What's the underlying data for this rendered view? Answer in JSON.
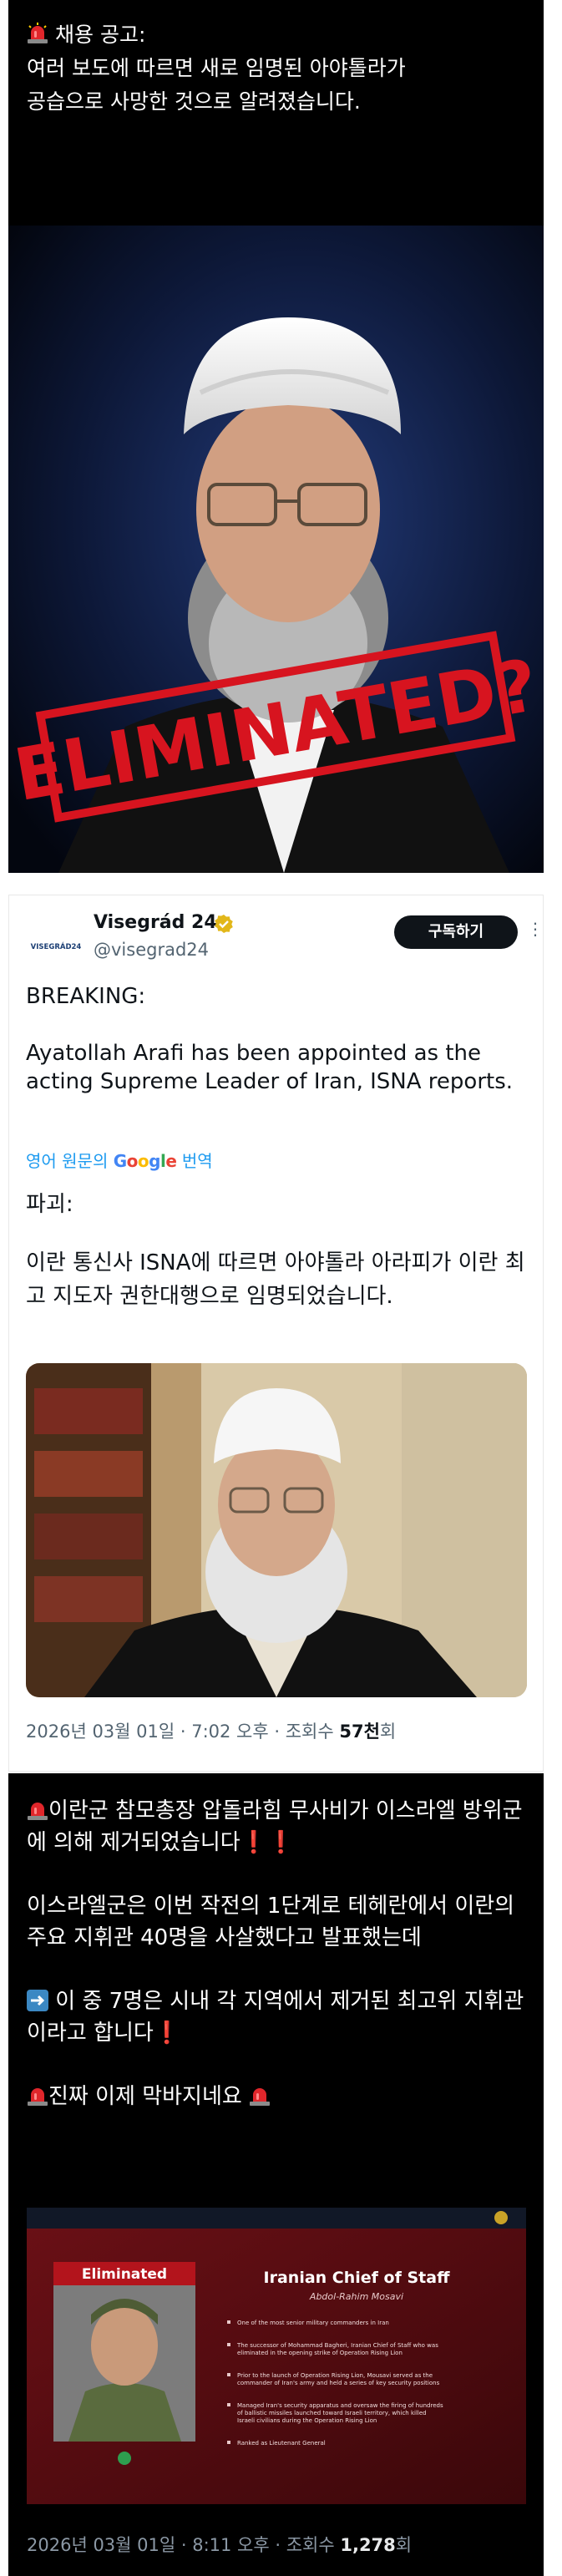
{
  "post1": {
    "line1": "채용 공고:",
    "line2": "여러 보도에 따르면 새로 임명된 아야톨라가",
    "line3": "공습으로 사망한 것으로 알려졌습니다.",
    "image_stamp": "ELIMINATED?"
  },
  "tweet": {
    "display_name": "Visegrád 24",
    "handle": "@visegrad24",
    "logo_text": "VISEGRÁD24",
    "subscribe_label": "구독하기",
    "more_label": "⋮",
    "breaking": "BREAKING:",
    "en_text": "Ayatollah Arafi has been appointed as the acting Supreme Leader of Iran, ISNA reports.",
    "translate_prefix": "영어 원문의",
    "translate_brand": "Google",
    "translate_suffix": "번역",
    "ko_breaking": "파괴:",
    "ko_text": "이란 통신사 ISNA에 따르면 아야톨라 아라피가 이란 최고 지도자 권한대행으로 임명되었습니다.",
    "date": "2026년 03월 01일 · 7:02 오후 · 조회수 ",
    "views": "57천",
    "views_suffix": "회"
  },
  "post3": {
    "p1": "이란군 참모총장 압돌라힘 무사비가 이스라엘 방위군에 의해 제거되었습니다",
    "p2": "이스라엘군은 이번 작전의 1단계로 테헤란에서 이란의 주요 지휘관 40명을 사살했다고 발표했는데",
    "p3": "이 중 7명은 시내 각 지역에서 제거된 최고위 지휘관이라고 합니다",
    "p4": "진짜 이제 막바지네요",
    "card": {
      "badge": "Eliminated",
      "title": "Iranian Chief of Staff",
      "subtitle": "Abdol-Rahim Mosavi",
      "bullets": [
        "One of the most senior military commanders in Iran",
        "The successor of Mohammad Bagheri, Iranian Chief of Staff who was eliminated in the opening strike of Operation Rising Lion",
        "Prior to the launch of Operation Rising Lion, Mousavi served as the commander of Iran's army and held a series of key security positions",
        "Managed Iran's security apparatus and oversaw the firing of hundreds of ballistic missiles launched toward Israeli territory, which killed Israeli civilians during the Operation Rising Lion",
        "Ranked as Lieutenant General"
      ]
    },
    "date": "2026년 03월 01일 · 8:11 오후 · 조회수 ",
    "views": "1,278",
    "views_suffix": "회"
  }
}
